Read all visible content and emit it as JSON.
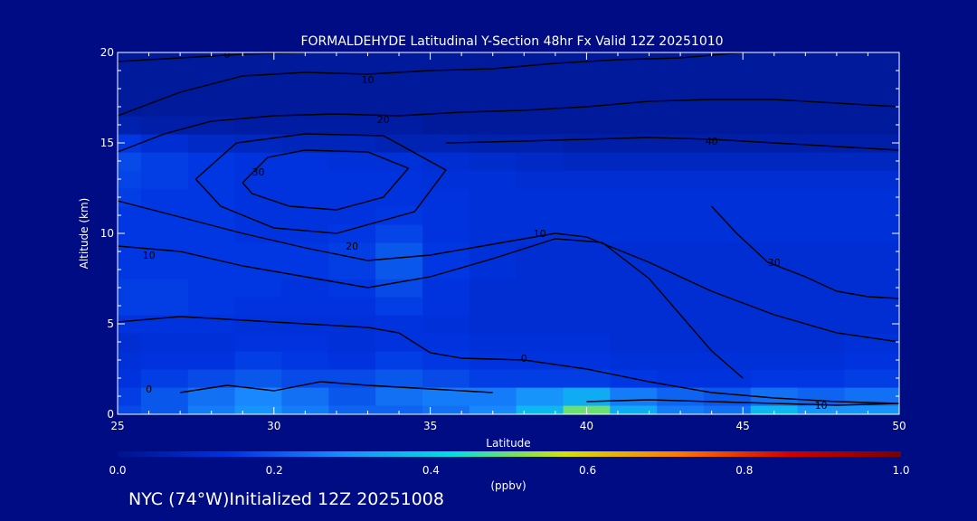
{
  "chart_data": {
    "type": "heatmap",
    "title": "FORMALDEHYDE Latitudinal Y-Section 48hr  Fx Valid 12Z 20251010",
    "xlabel": "Latitude",
    "ylabel": "Altitude (km)",
    "xlim": [
      25,
      50
    ],
    "ylim": [
      0,
      20
    ],
    "x_ticks": [
      25,
      30,
      35,
      40,
      45,
      50
    ],
    "y_ticks": [
      0,
      5,
      10,
      15,
      20
    ],
    "colorbar": {
      "label": "(ppbv)",
      "range": [
        0.0,
        1.0
      ],
      "tick_labels": [
        "0.0",
        "0.2",
        "0.4",
        "0.6",
        "0.8",
        "1.0"
      ],
      "colors": [
        "#00138a",
        "#0033e0",
        "#1a8cff",
        "#00e0e0",
        "#d8e000",
        "#ff7a00",
        "#d00000",
        "#7a0000"
      ]
    },
    "field": {
      "x": [
        25,
        26.5,
        28,
        29.5,
        31,
        32.5,
        34,
        35.5,
        37,
        38.5,
        40,
        41.5,
        43,
        44.5,
        46,
        47.5,
        49,
        50
      ],
      "y": [
        0,
        1,
        2,
        3,
        4,
        5,
        6,
        7,
        8,
        9,
        10,
        11,
        12,
        13,
        14,
        15,
        16,
        17,
        18,
        19,
        20
      ],
      "z": [
        [
          0.18,
          0.2,
          0.26,
          0.3,
          0.26,
          0.22,
          0.22,
          0.24,
          0.28,
          0.36,
          0.5,
          0.34,
          0.26,
          0.24,
          0.36,
          0.3,
          0.3,
          0.3
        ],
        [
          0.16,
          0.2,
          0.24,
          0.28,
          0.24,
          0.2,
          0.24,
          0.26,
          0.26,
          0.3,
          0.34,
          0.26,
          0.22,
          0.2,
          0.24,
          0.22,
          0.24,
          0.24
        ],
        [
          0.14,
          0.16,
          0.18,
          0.2,
          0.18,
          0.18,
          0.2,
          0.18,
          0.16,
          0.16,
          0.16,
          0.15,
          0.14,
          0.14,
          0.15,
          0.15,
          0.16,
          0.16
        ],
        [
          0.13,
          0.14,
          0.14,
          0.16,
          0.15,
          0.14,
          0.16,
          0.15,
          0.14,
          0.14,
          0.14,
          0.13,
          0.13,
          0.13,
          0.13,
          0.13,
          0.14,
          0.14
        ],
        [
          0.12,
          0.13,
          0.13,
          0.14,
          0.14,
          0.13,
          0.14,
          0.14,
          0.13,
          0.13,
          0.13,
          0.12,
          0.12,
          0.12,
          0.12,
          0.12,
          0.13,
          0.13
        ],
        [
          0.14,
          0.14,
          0.14,
          0.13,
          0.13,
          0.13,
          0.14,
          0.13,
          0.12,
          0.12,
          0.12,
          0.12,
          0.12,
          0.12,
          0.12,
          0.12,
          0.12,
          0.12
        ],
        [
          0.16,
          0.16,
          0.15,
          0.14,
          0.14,
          0.14,
          0.16,
          0.14,
          0.12,
          0.12,
          0.12,
          0.12,
          0.12,
          0.12,
          0.12,
          0.12,
          0.12,
          0.12
        ],
        [
          0.16,
          0.16,
          0.15,
          0.15,
          0.14,
          0.15,
          0.18,
          0.14,
          0.12,
          0.12,
          0.12,
          0.12,
          0.12,
          0.12,
          0.12,
          0.12,
          0.12,
          0.12
        ],
        [
          0.15,
          0.15,
          0.15,
          0.15,
          0.15,
          0.16,
          0.2,
          0.15,
          0.13,
          0.12,
          0.12,
          0.12,
          0.12,
          0.12,
          0.12,
          0.12,
          0.12,
          0.12
        ],
        [
          0.15,
          0.15,
          0.15,
          0.15,
          0.15,
          0.16,
          0.2,
          0.15,
          0.13,
          0.12,
          0.12,
          0.12,
          0.12,
          0.12,
          0.12,
          0.12,
          0.12,
          0.12
        ],
        [
          0.15,
          0.15,
          0.15,
          0.14,
          0.14,
          0.15,
          0.17,
          0.14,
          0.13,
          0.13,
          0.13,
          0.13,
          0.13,
          0.13,
          0.13,
          0.13,
          0.13,
          0.13
        ],
        [
          0.15,
          0.15,
          0.15,
          0.14,
          0.14,
          0.14,
          0.15,
          0.14,
          0.13,
          0.13,
          0.13,
          0.13,
          0.13,
          0.13,
          0.13,
          0.13,
          0.13,
          0.13
        ],
        [
          0.16,
          0.15,
          0.15,
          0.14,
          0.14,
          0.14,
          0.14,
          0.14,
          0.13,
          0.13,
          0.13,
          0.13,
          0.13,
          0.13,
          0.13,
          0.13,
          0.13,
          0.13
        ],
        [
          0.17,
          0.16,
          0.15,
          0.14,
          0.14,
          0.14,
          0.14,
          0.13,
          0.13,
          0.12,
          0.12,
          0.12,
          0.12,
          0.12,
          0.12,
          0.12,
          0.12,
          0.12
        ],
        [
          0.18,
          0.16,
          0.15,
          0.14,
          0.14,
          0.13,
          0.13,
          0.12,
          0.11,
          0.1,
          0.09,
          0.09,
          0.09,
          0.09,
          0.09,
          0.09,
          0.09,
          0.09
        ],
        [
          0.15,
          0.12,
          0.1,
          0.09,
          0.08,
          0.08,
          0.07,
          0.07,
          0.06,
          0.06,
          0.05,
          0.05,
          0.05,
          0.05,
          0.05,
          0.05,
          0.05,
          0.05
        ],
        [
          0.06,
          0.05,
          0.05,
          0.04,
          0.04,
          0.04,
          0.04,
          0.03,
          0.03,
          0.03,
          0.03,
          0.03,
          0.03,
          0.03,
          0.03,
          0.03,
          0.03,
          0.03
        ],
        [
          0.03,
          0.03,
          0.03,
          0.03,
          0.03,
          0.03,
          0.03,
          0.03,
          0.03,
          0.03,
          0.03,
          0.03,
          0.03,
          0.03,
          0.03,
          0.03,
          0.03,
          0.03
        ],
        [
          0.03,
          0.03,
          0.03,
          0.03,
          0.03,
          0.03,
          0.03,
          0.03,
          0.03,
          0.03,
          0.03,
          0.03,
          0.03,
          0.03,
          0.03,
          0.03,
          0.03,
          0.03
        ],
        [
          0.03,
          0.03,
          0.03,
          0.03,
          0.03,
          0.03,
          0.03,
          0.03,
          0.03,
          0.03,
          0.03,
          0.03,
          0.03,
          0.03,
          0.03,
          0.03,
          0.03,
          0.03
        ],
        [
          0.03,
          0.03,
          0.03,
          0.03,
          0.03,
          0.03,
          0.03,
          0.03,
          0.03,
          0.03,
          0.03,
          0.03,
          0.03,
          0.03,
          0.03,
          0.03,
          0.03,
          0.03
        ]
      ]
    },
    "contours": [
      {
        "level": "0",
        "points": [
          [
            25,
            19.5
          ],
          [
            27,
            19.7
          ],
          [
            29,
            19.9
          ],
          [
            31,
            20
          ]
        ],
        "label_at": [
          28.5,
          19.9
        ]
      },
      {
        "level": "10",
        "points": [
          [
            25,
            16.5
          ],
          [
            27,
            17.8
          ],
          [
            29,
            18.7
          ],
          [
            31,
            18.9
          ],
          [
            33,
            18.8
          ],
          [
            35,
            19.0
          ],
          [
            37,
            19.1
          ],
          [
            39,
            19.4
          ],
          [
            41,
            19.6
          ],
          [
            43,
            19.7
          ],
          [
            45,
            20
          ]
        ],
        "label_at": [
          33,
          18.5
        ]
      },
      {
        "level": "20",
        "points": [
          [
            25,
            14.5
          ],
          [
            26.5,
            15.5
          ],
          [
            28,
            16.2
          ],
          [
            30,
            16.5
          ],
          [
            32,
            16.6
          ],
          [
            34,
            16.5
          ],
          [
            36,
            16.7
          ],
          [
            38,
            16.8
          ],
          [
            40,
            17.0
          ],
          [
            42,
            17.3
          ],
          [
            44,
            17.4
          ],
          [
            46,
            17.4
          ],
          [
            48,
            17.2
          ],
          [
            50,
            17.0
          ]
        ],
        "label_at": [
          33.5,
          16.3
        ]
      },
      {
        "level": "40",
        "points": [
          [
            35.5,
            15.0
          ],
          [
            38,
            15.1
          ],
          [
            40,
            15.2
          ],
          [
            42,
            15.3
          ],
          [
            44,
            15.2
          ],
          [
            46,
            15.0
          ],
          [
            48,
            14.8
          ],
          [
            50,
            14.6
          ]
        ],
        "label_at": [
          44,
          15.1
        ]
      },
      {
        "level": "30",
        "points": [
          [
            29,
            12.8
          ],
          [
            29.8,
            14.2
          ],
          [
            31,
            14.6
          ],
          [
            33,
            14.5
          ],
          [
            34.3,
            13.6
          ],
          [
            33.5,
            12.0
          ],
          [
            32,
            11.3
          ],
          [
            30.5,
            11.5
          ],
          [
            29.3,
            12.2
          ],
          [
            29,
            12.8
          ]
        ],
        "label_at": [
          29.5,
          13.4
        ]
      },
      {
        "level": "20",
        "points": [
          [
            27.5,
            13.0
          ],
          [
            28.8,
            15.0
          ],
          [
            31,
            15.5
          ],
          [
            33.5,
            15.4
          ],
          [
            35.5,
            13.5
          ],
          [
            34.5,
            11.2
          ],
          [
            32,
            10.0
          ],
          [
            30,
            10.3
          ],
          [
            28.3,
            11.5
          ],
          [
            27.5,
            13.0
          ]
        ],
        "label_at": [
          32.5,
          9.3
        ]
      },
      {
        "level": "10",
        "points": [
          [
            25,
            11.8
          ],
          [
            27,
            10.9
          ],
          [
            29,
            10.0
          ],
          [
            31,
            9.2
          ],
          [
            33,
            8.5
          ],
          [
            35,
            8.8
          ],
          [
            37,
            9.4
          ],
          [
            39,
            10.0
          ],
          [
            40,
            9.8
          ],
          [
            42,
            8.4
          ],
          [
            44,
            6.8
          ],
          [
            46,
            5.5
          ],
          [
            48,
            4.5
          ],
          [
            50,
            4.0
          ]
        ],
        "label_at": [
          26,
          8.8
        ]
      },
      {
        "level": "10",
        "points": [
          [
            25,
            9.3
          ],
          [
            27,
            9.0
          ],
          [
            29,
            8.2
          ],
          [
            31,
            7.6
          ],
          [
            33,
            7.0
          ],
          [
            35,
            7.6
          ],
          [
            37,
            8.6
          ],
          [
            39,
            9.7
          ],
          [
            40.5,
            9.5
          ],
          [
            42,
            7.5
          ],
          [
            43,
            5.5
          ],
          [
            44,
            3.5
          ],
          [
            45,
            2.0
          ]
        ],
        "label_at": [
          38.5,
          10.0
        ]
      },
      {
        "level": "30",
        "points": [
          [
            44,
            11.5
          ],
          [
            44.8,
            10.0
          ],
          [
            45.8,
            8.4
          ],
          [
            47,
            7.6
          ],
          [
            48,
            6.8
          ],
          [
            49,
            6.5
          ],
          [
            50,
            6.4
          ]
        ],
        "label_at": [
          46,
          8.4
        ]
      },
      {
        "level": "0",
        "points": [
          [
            25,
            5.1
          ],
          [
            27,
            5.4
          ],
          [
            29,
            5.2
          ],
          [
            31,
            5.0
          ],
          [
            33,
            4.8
          ],
          [
            34,
            4.5
          ],
          [
            35,
            3.4
          ],
          [
            36,
            3.1
          ],
          [
            38,
            3.0
          ],
          [
            40,
            2.5
          ],
          [
            42,
            1.8
          ],
          [
            44,
            1.2
          ],
          [
            46,
            0.9
          ],
          [
            48,
            0.7
          ],
          [
            50,
            0.6
          ]
        ],
        "label_at": [
          38,
          3.1
        ]
      },
      {
        "level": "10",
        "points": [
          [
            40,
            0.7
          ],
          [
            42,
            0.8
          ],
          [
            44,
            0.7
          ],
          [
            46,
            0.6
          ],
          [
            48,
            0.5
          ],
          [
            50,
            0.6
          ]
        ],
        "label_at": [
          47.5,
          0.5
        ]
      },
      {
        "level": "0",
        "points": [
          [
            27,
            1.2
          ],
          [
            28.5,
            1.6
          ],
          [
            30,
            1.3
          ],
          [
            31.5,
            1.8
          ],
          [
            33,
            1.6
          ],
          [
            35,
            1.4
          ],
          [
            37,
            1.2
          ]
        ],
        "label_at": [
          26,
          1.4
        ]
      }
    ]
  },
  "footer": {
    "text": "NYC (74°W)Initialized 12Z 20251008"
  }
}
